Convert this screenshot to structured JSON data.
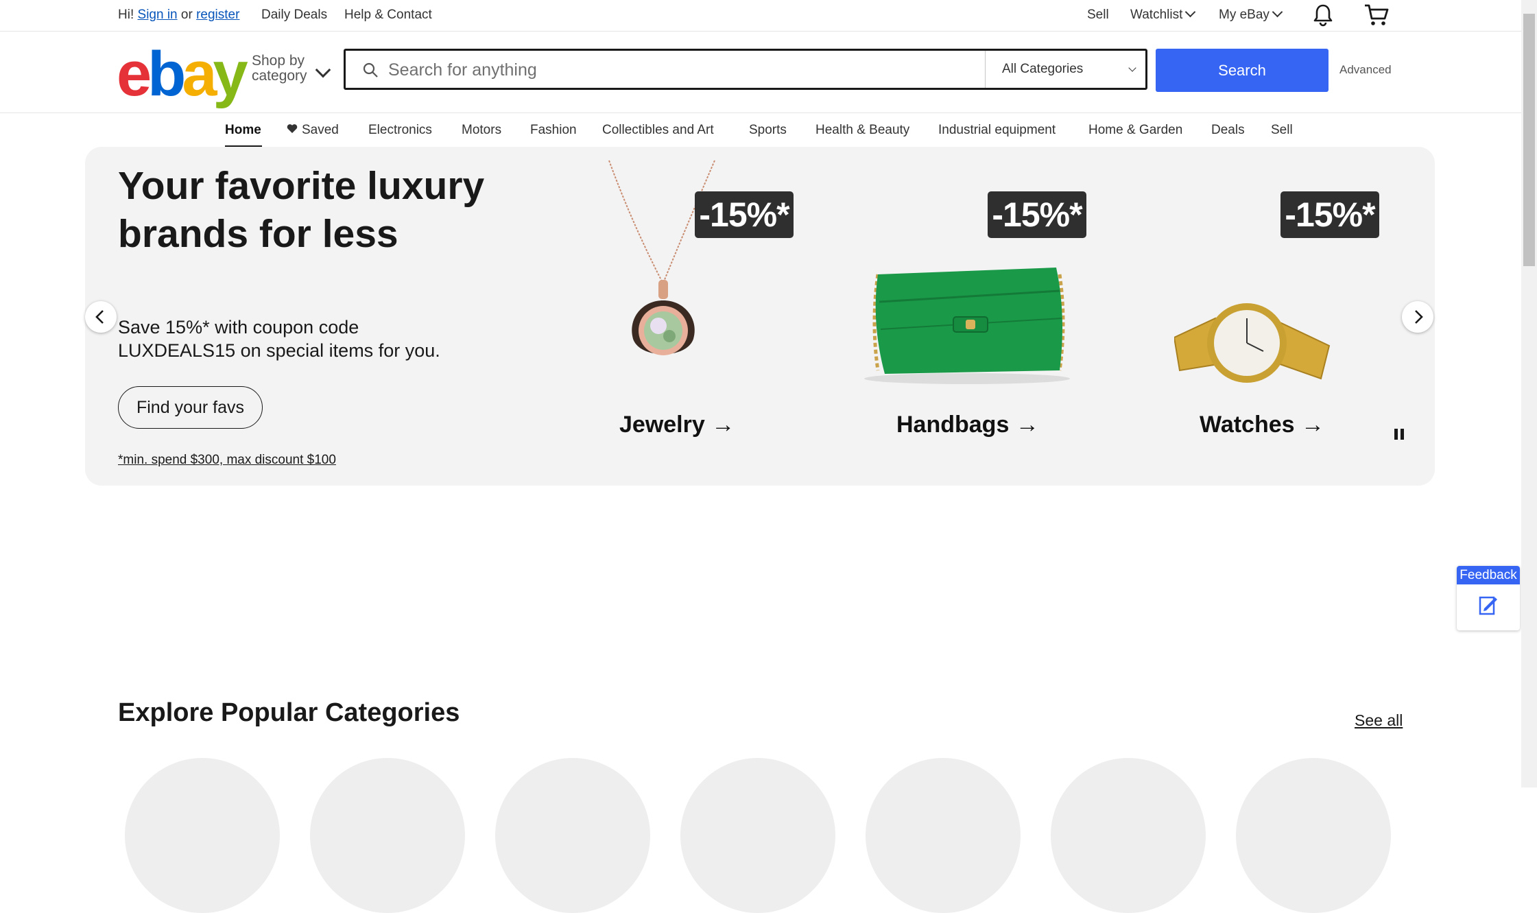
{
  "topbar": {
    "greeting_prefix": "Hi!",
    "sign_in": "Sign in",
    "or": "or",
    "register": "register",
    "daily_deals": "Daily Deals",
    "help_contact": "Help & Contact",
    "sell": "Sell",
    "watchlist": "Watchlist",
    "my_ebay": "My eBay"
  },
  "header": {
    "logo_letters": [
      "e",
      "b",
      "a",
      "y"
    ],
    "shop_by_line1": "Shop by",
    "shop_by_line2": "category",
    "search_placeholder": "Search for anything",
    "category_selected": "All Categories",
    "search_button": "Search",
    "advanced": "Advanced"
  },
  "nav": {
    "items": [
      "Home",
      "Saved",
      "Electronics",
      "Motors",
      "Fashion",
      "Collectibles and Art",
      "Sports",
      "Health & Beauty",
      "Industrial equipment",
      "Home & Garden",
      "Deals",
      "Sell"
    ],
    "active": "Home"
  },
  "banner": {
    "headline": "Your favorite luxury brands for less",
    "subtext": "Save 15%* with coupon code LUXDEALS15 on special items for you.",
    "cta": "Find your favs",
    "footnote": "*min. spend $300, max discount $100",
    "products": [
      {
        "badge": "-15%*",
        "label": "Jewelry"
      },
      {
        "badge": "-15%*",
        "label": "Handbags"
      },
      {
        "badge": "-15%*",
        "label": "Watches"
      }
    ]
  },
  "feedback": {
    "label": "Feedback"
  },
  "explore": {
    "title": "Explore Popular Categories",
    "see_all": "See all"
  },
  "colors": {
    "accent": "#3665f3",
    "logo_e": "#e53238",
    "logo_b": "#0064d2",
    "logo_a": "#f5af02",
    "logo_y": "#86b817"
  }
}
